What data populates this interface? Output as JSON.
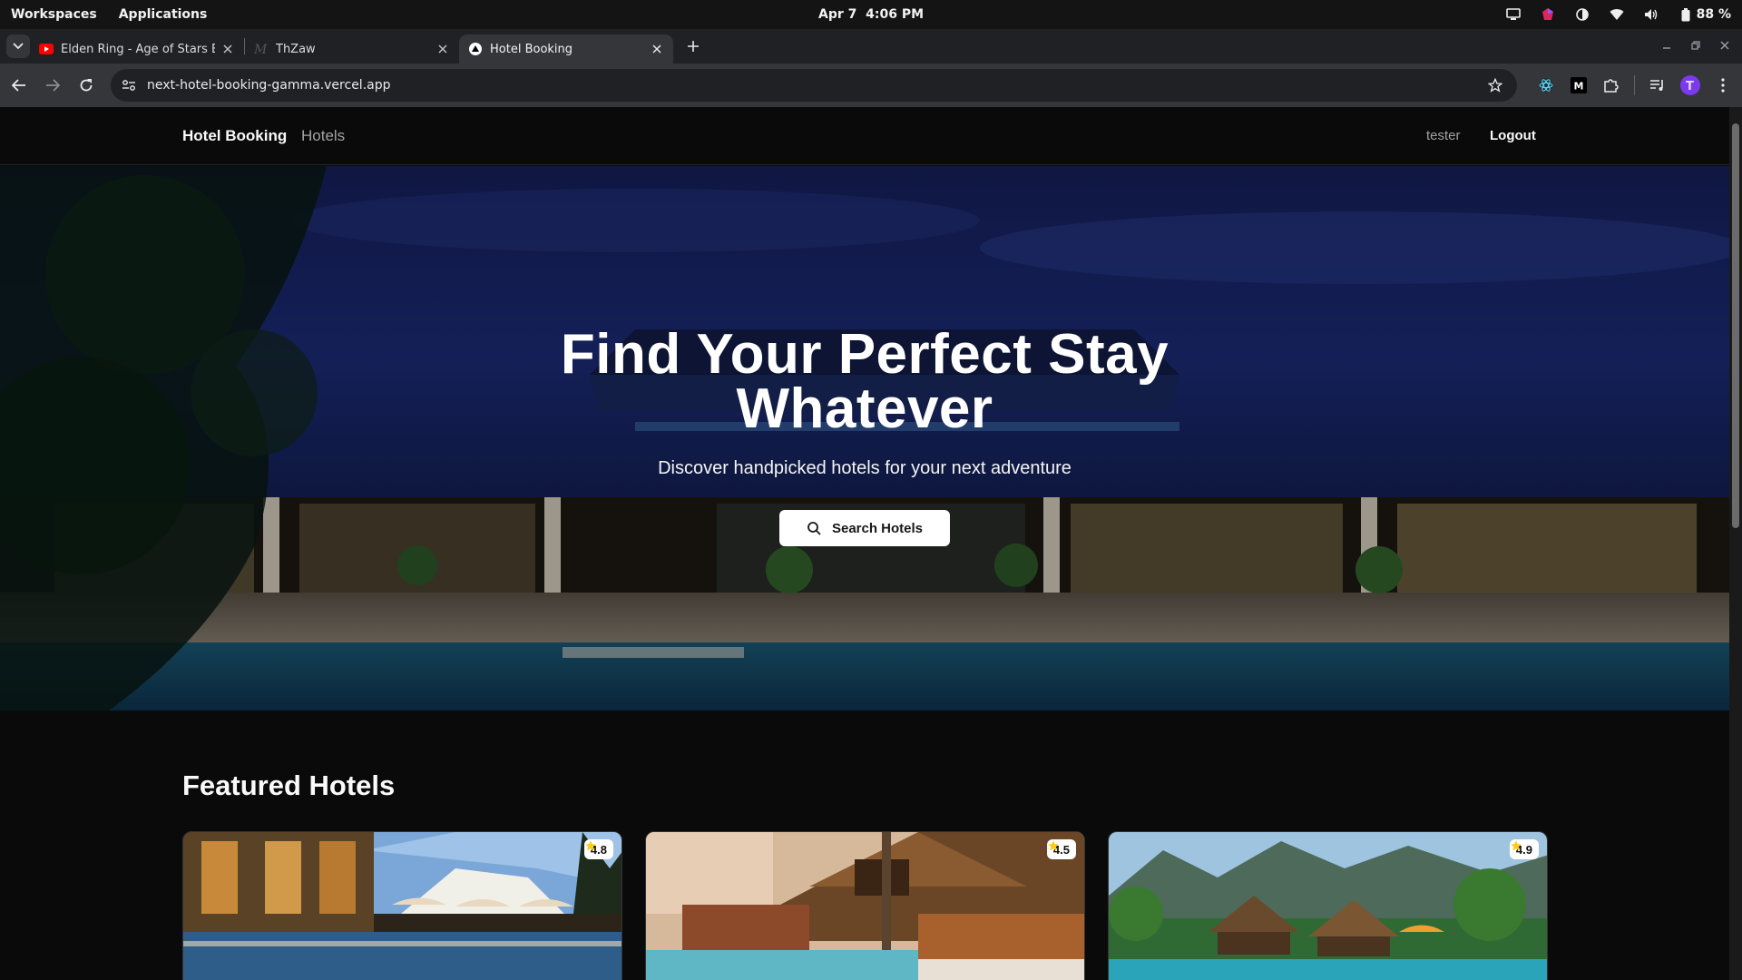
{
  "os": {
    "workspaces": "Workspaces",
    "applications": "Applications",
    "date": "Apr 7",
    "time": "4:06 PM",
    "battery": "88 %"
  },
  "browser": {
    "tabs": [
      {
        "title": "Elden Ring - Age of Stars Ending",
        "favicon": "youtube-icon"
      },
      {
        "title": "ThZaw",
        "favicon": "medium-icon"
      },
      {
        "title": "Hotel Booking",
        "favicon": "vercel-icon"
      }
    ],
    "url": "next-hotel-booking-gamma.vercel.app"
  },
  "site": {
    "brand": "Hotel Booking",
    "nav_hotels": "Hotels",
    "user": "tester",
    "logout": "Logout"
  },
  "hero": {
    "title_line1": "Find Your Perfect Stay",
    "title_line2": "Whatever",
    "subtitle": "Discover handpicked hotels for your next adventure",
    "button": "Search Hotels"
  },
  "featured": {
    "title": "Featured Hotels",
    "hotels": [
      {
        "rating": "4.8"
      },
      {
        "rating": "4.5"
      },
      {
        "rating": "4.9"
      }
    ]
  },
  "colors": {
    "accent_star": "#facc15",
    "page_bg": "#0a0a0a"
  }
}
